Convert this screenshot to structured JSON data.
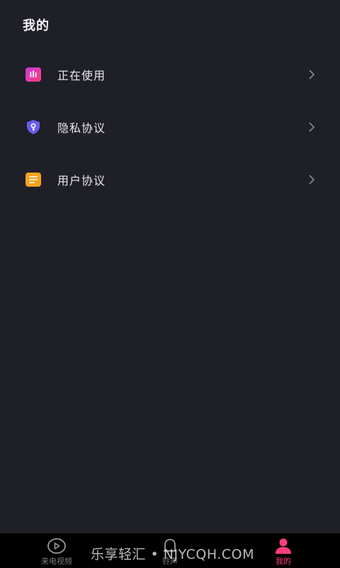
{
  "header": {
    "title": "我的"
  },
  "menu": {
    "items": [
      {
        "label": "正在使用",
        "icon": "sound-bars-icon",
        "color": "#e6398e"
      },
      {
        "label": "隐私协议",
        "icon": "shield-key-icon",
        "color": "#6a5cf0"
      },
      {
        "label": "用户协议",
        "icon": "document-icon",
        "color": "#f7a21b"
      }
    ]
  },
  "tabbar": {
    "tabs": [
      {
        "label": "来电视频",
        "icon": "play-circle-icon",
        "active": false
      },
      {
        "label": "铃声",
        "icon": "bell-icon",
        "active": false
      },
      {
        "label": "我的",
        "icon": "person-icon",
        "active": true
      }
    ],
    "active_color": "#ff3d7f",
    "inactive_color": "#7a7a80"
  },
  "watermark": {
    "text": "乐享轻汇 • NJYCQH.COM"
  }
}
